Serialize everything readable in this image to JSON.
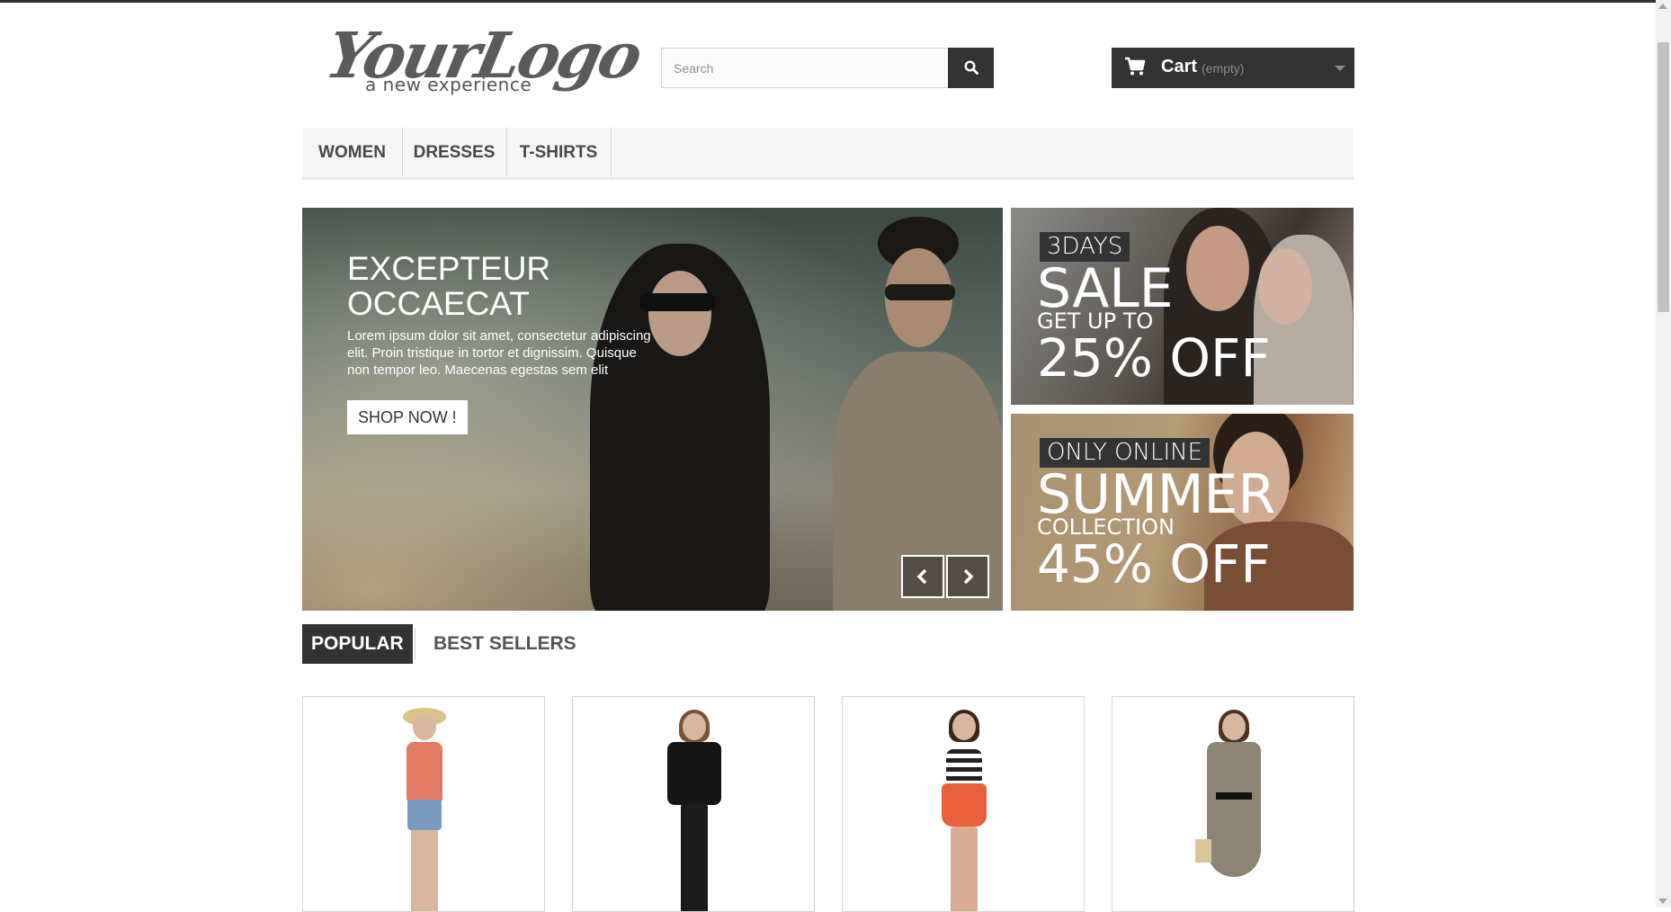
{
  "header": {
    "logo_main": "YourLogo",
    "logo_sub": "a new experience",
    "search_placeholder": "Search",
    "search_icon": "search-icon",
    "cart_label": "Cart",
    "cart_status": "(empty)",
    "cart_icon": "shopping-cart-icon"
  },
  "menu": {
    "items": [
      {
        "label": "WOMEN"
      },
      {
        "label": "DRESSES"
      },
      {
        "label": "T-SHIRTS"
      }
    ]
  },
  "slider": {
    "title_line1": "EXCEPTEUR",
    "title_line2": "OCCAECAT",
    "text": "Lorem ipsum dolor sit amet, consectetur adipiscing elit. Proin tristique in tortor et dignissim. Quisque non tempor leo. Maecenas egestas sem elit",
    "button": "SHOP NOW !",
    "prev_icon": "chevron-left-icon",
    "next_icon": "chevron-right-icon"
  },
  "banners": [
    {
      "badge": "3DAYS",
      "big": "SALE",
      "mid": "GET UP TO",
      "off": "25% OFF"
    },
    {
      "badge": "ONLY ONLINE",
      "big": "SUMMER",
      "mid": "COLLECTION",
      "off": "45% OFF"
    }
  ],
  "tabs": {
    "popular": "POPULAR",
    "best_sellers": "BEST SELLERS"
  },
  "colors": {
    "dark": "#333333",
    "menu_bg": "#f6f6f6",
    "border": "#d6d4d4"
  }
}
